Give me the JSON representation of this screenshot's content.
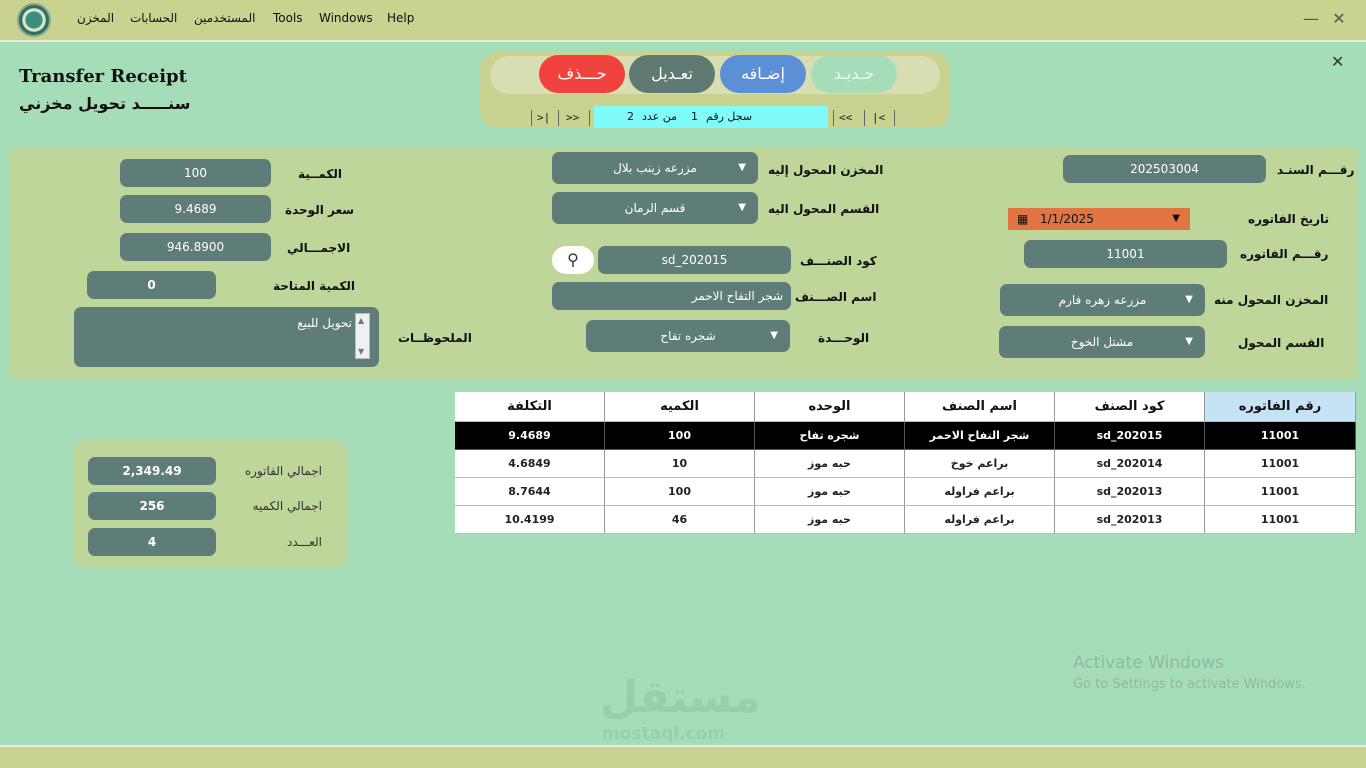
{
  "menu": {
    "items": [
      "المخزن",
      "الحسابات",
      "المستخدمين",
      "Tools",
      "Windows",
      "Help"
    ],
    "window_controls": [
      "—",
      "✕",
      "✕"
    ]
  },
  "form": {
    "title_en": "Transfer Receipt",
    "title_ar": "سنـــــد تحويل مخزني"
  },
  "toolbar": {
    "delete_label": "حـــذف",
    "edit_label": "تعـديل",
    "add_label": "إضـافه",
    "new_label": "جـديـد"
  },
  "nav": {
    "first": "|<",
    "prev": "<<",
    "next": ">>",
    "last": ">|",
    "record_label": "سجل رقم",
    "record_current": "1",
    "of_label": "من عدد",
    "record_total": "2"
  },
  "fields": {
    "doc_number_label": "رقـــم السنـد",
    "doc_number": "202503004",
    "invoice_date_label": "تاريخ الفاتوره",
    "invoice_date": "1/1/2025",
    "invoice_number_label": "رقـــم الفاتوره",
    "invoice_number": "11001",
    "from_store_label": "المخزن المحول منه",
    "from_store": "مزرعه زهره فارم",
    "from_section_label": "القسم المحول",
    "from_section": "مشتل الخوخ",
    "to_store_label": "المخزن المحول إليه",
    "to_store": "مزرعه زينب بلال",
    "to_section_label": "القسم المحول اليه",
    "to_section": "قسم الرمان",
    "item_code_label": "كود الصنـــف",
    "item_code": "sd_202015",
    "item_name_label": "اسم الصـــنف",
    "item_name": "شجر التفاح الاحمر",
    "unit_label": "الوحـــدة",
    "unit": "شجره تفاح",
    "quantity_label": "الكمــية",
    "quantity": "100",
    "unit_price_label": "سعر الوحدة",
    "unit_price": "9.4689",
    "total_label": "الاجمـــالي",
    "total": "946.8900",
    "available_label": "الكمية المتاحة",
    "available": "0",
    "notes_label": "الملحوظــات",
    "notes": "تحويل للبيع"
  },
  "totals": {
    "invoice_total_label": "اجمالي الفاتوره",
    "invoice_total": "2,349.49",
    "qty_total_label": "اجمالي الكميه",
    "qty_total": "256",
    "count_label": "العـــدد",
    "count": "4"
  },
  "grid": {
    "headers": [
      "التكلفة",
      "الكميه",
      "الوحده",
      "اسم الصنف",
      "كود الصنف",
      "رقم الفاتوره"
    ],
    "rows": [
      [
        "9.4689",
        "100",
        "شجره تفاح",
        "شجر التفاح الاحمر",
        "sd_202015",
        "11001"
      ],
      [
        "4.6849",
        "10",
        "حبه موز",
        "براعم خوخ",
        "sd_202014",
        "11001"
      ],
      [
        "8.7644",
        "100",
        "حبه موز",
        "براعم فراوله",
        "sd_202013",
        "11001"
      ],
      [
        "10.4199",
        "46",
        "حبه موز",
        "براعم فراوله",
        "sd_202013",
        "11001"
      ]
    ]
  },
  "watermark": {
    "activate_title": "Activate Windows",
    "activate_sub": "Go to Settings to activate Windows.",
    "brand_ar": "مستقل",
    "brand_en": "mostaql.com"
  },
  "colors": {
    "main_bg": "#a6ddb9",
    "bar_bg": "#c9d28f",
    "field_bg": "#5f7d78",
    "delete": "#f2423e",
    "add": "#5b8fd6",
    "date_field": "#e07543",
    "record_box": "#80fbfb"
  }
}
